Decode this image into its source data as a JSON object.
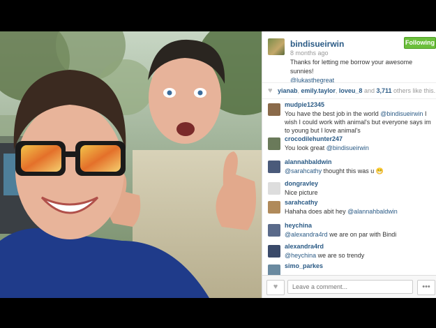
{
  "post": {
    "username": "bindisueirwin",
    "time_ago": "8 months ago",
    "follow_label": "Following",
    "caption_text": "Thanks for letting me borrow your awesome sunnies!",
    "caption_mention": "@lukasthegreat"
  },
  "likes": {
    "user1": "yianab",
    "user2": "emily.taylor",
    "user3": "loveu_8",
    "sep": ", ",
    "and": "and",
    "count": "3,711",
    "suffix": "others like this."
  },
  "comments": [
    {
      "user": "mudpie12345",
      "pre": "You have the best job in the world ",
      "mention": "@bindisueirwin",
      "post": " I wish I could work with animal's but everyone says im to young but I love animal's",
      "color": "#8a6a4a"
    },
    {
      "user": "crocodilehunter247",
      "pre": "You look great ",
      "mention": "@bindisueirwin",
      "post": "",
      "color": "#6a7a5a"
    },
    {
      "user": "alannahbaldwin",
      "pre": "",
      "mention": "@sarahcathy",
      "post": " thought this was u 😁",
      "color": "#4a5a7a"
    },
    {
      "user": "dongravley",
      "pre": "Nice picture",
      "mention": "",
      "post": "",
      "color": "#dddddd"
    },
    {
      "user": "sarahcathy",
      "pre": "Hahaha does abit hey ",
      "mention": "@alannahbaldwin",
      "post": "",
      "color": "#b08a5a"
    },
    {
      "user": "heychina",
      "pre": "",
      "mention": "@alexandra4rd",
      "post": " we are on par with Bindi",
      "color": "#5a6a8a"
    },
    {
      "user": "alexandra4rd",
      "pre": "",
      "mention": "@heychina",
      "post": " we are so trendy",
      "color": "#3a4a6a"
    },
    {
      "user": "simo_parkes",
      "pre": "",
      "mention": "",
      "post": "",
      "color": "#6a8aa0"
    }
  ],
  "footer": {
    "comment_placeholder": "Leave a comment...",
    "like_icon": "heart-icon",
    "more_icon": "ellipsis-icon",
    "more_label": "•••",
    "heart_label": "♥"
  },
  "colors": {
    "link": "#2a5a85",
    "follow": "#6bbf3b"
  }
}
